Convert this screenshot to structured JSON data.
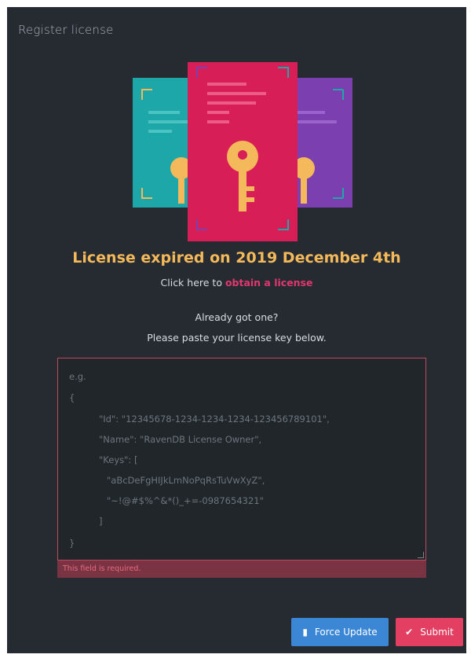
{
  "dialog": {
    "title": "Register license"
  },
  "status": {
    "headline": "License expired on 2019 December 4th",
    "obtain_prefix": "Click here to ",
    "obtain_link": "obtain a license",
    "already": "Already got one?",
    "paste_instructions": "Please paste your license key below."
  },
  "license_input": {
    "value": "",
    "placeholder_lines": [
      "e.g.",
      "{",
      "\"Id\": \"12345678-1234-1234-1234-123456789101\",",
      "\"Name\": \"RavenDB License Owner\",",
      "\"Keys\": [",
      "\"aBcDeFgHIJkLmNoPqRsTuVwXyZ\",",
      "\"~!@#$%^&*()_+=-0987654321\"",
      "]",
      "}"
    ],
    "error": "This field is required."
  },
  "buttons": {
    "force_update": {
      "label": "Force Update",
      "icon": "force-update-icon"
    },
    "submit": {
      "label": "Submit",
      "icon": "check-icon"
    }
  },
  "colors": {
    "background": "#262b31",
    "headline": "#f4b95b",
    "link": "#e2376e",
    "error": "#c1475c",
    "force_update": "#3b87d6",
    "submit": "#e23f62"
  }
}
